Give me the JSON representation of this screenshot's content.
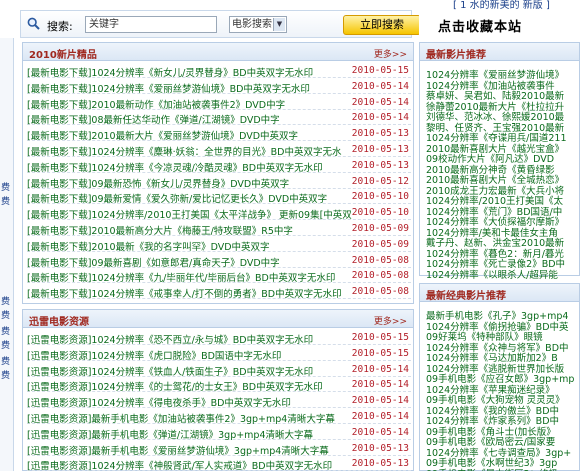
{
  "top_strip": {
    "right_text": "[ 1 水的新美的 新版 ]"
  },
  "search": {
    "label": "搜索:",
    "input_value": "关键字",
    "select_value": "电影搜索",
    "button_label": "立即搜索"
  },
  "bookmark": {
    "label": "点击收藏本站"
  },
  "left_edge_chars": [
    "费",
    "费",
    "费",
    "费",
    "费",
    "费",
    "费",
    "费"
  ],
  "new_releases": {
    "title": "2010新片精品",
    "more": "更多>>",
    "rows": [
      {
        "text": "[最新电影下载]1024分辨率《新女儿/灵界替身》BD中英双字无水印",
        "date": "2010-05-15"
      },
      {
        "text": "[最新电影下载]1024分辨率《爱丽丝梦游仙境》BD中英双字无水印",
        "date": "2010-05-14"
      },
      {
        "text": "[最新电影下载]2010最新动作《加油站被袭事件2》DVD中字",
        "date": "2010-05-14"
      },
      {
        "text": "[最新电影下载]08最新任达华动作《弹道/江湖镜》DVD中字",
        "date": "2010-05-14"
      },
      {
        "text": "[最新电影下载]2010最新大片《爱丽丝梦游仙境》DVD中英双字",
        "date": "2010-05-13"
      },
      {
        "text": "[最新电影下载]1024分辨率《麋琳·妖翁：全世界的目光》BD中英双字无水",
        "date": "2010-05-13"
      },
      {
        "text": "[最新电影下载]1024分辨率《今凉灵魂/冷酷灵魂》BD中英双字无水印",
        "date": "2010-05-13"
      },
      {
        "text": "[最新电影下载]09最新恐怖《新女儿/灵界替身》DVD中英双字",
        "date": "2010-05-12"
      },
      {
        "text": "[最新电影下载]09最新爱情《爱久弥新/爱比记忆更长久》DVD中英双字",
        "date": "2010-05-10"
      },
      {
        "text": "[最新电影下载]1024分辨率/2010王打美国《太平洋战争》 更新09集[中英双",
        "date": "2010-05-10"
      },
      {
        "text": "[最新电影下载]2010最新高分大片《梅藤王/特攻联盟》R5中字",
        "date": "2010-05-09"
      },
      {
        "text": "[最新电影下载]2010最新《我的名字叫罕》DVD中英双字",
        "date": "2010-05-09"
      },
      {
        "text": "[最新电影下载]09最新喜剧《如意郎君/真命天子》DVD中字",
        "date": "2010-05-08"
      },
      {
        "text": "[最新电影下载]1024分辨率《九/毕丽年代/毕丽后台》BD中英双字无水印",
        "date": "2010-05-08"
      },
      {
        "text": "[最新电影下载]1024分辨率《戒事幸人/打不倒的勇者》BD中英双字无水印",
        "date": "2010-05-08"
      }
    ]
  },
  "xunlei": {
    "title": "迅雷电影资源",
    "more": "更多>>",
    "rows": [
      {
        "text": "[迅雷电影资源]1024分辨率《恐不西立/永与城》BD中英双字无水印",
        "date": "2010-05-15"
      },
      {
        "text": "[迅雷电影资源]1024分辨率《虎口脱险》BD国语中字无水印",
        "date": "2010-05-15"
      },
      {
        "text": "[迅雷电影资源]1024分辨率《铁血人/铁面生子》BD中英双字无水印",
        "date": "2010-05-14"
      },
      {
        "text": "[迅雷电影资源]1024分辨率《的士鸳花/的士女王》BD中英双字无水印",
        "date": "2010-05-14"
      },
      {
        "text": "[迅雷电影资源]1024分辨率《得电夜杀手》BD中英双字无水印",
        "date": "2010-05-14"
      },
      {
        "text": "[迅雷电影资源]最新手机电影《加油站被袭事件2》3gp+mp4清晰大字幕",
        "date": "2010-05-14"
      },
      {
        "text": "[迅雷电影资源]最新手机电影《弹道/江湖镜》3gp+mp4清晰大字幕",
        "date": "2010-05-14"
      },
      {
        "text": "[迅雷电影资源]最新手机电影《爱丽丝梦游仙境》3gp+mp4清晰大字幕",
        "date": "2010-05-13"
      },
      {
        "text": "[迅雷电影资源]1024分辨率《神般肾武/军人实戒道》BD中英双字无水印",
        "date": "2010-05-13"
      }
    ]
  },
  "latest_recommend": {
    "title": "最新影片推荐",
    "lines": [
      "1024分辨率《爱丽丝梦游仙境》",
      "1024分辨率《加油站被袭事件",
      "蔡卓妍、吴君如、陆毅2010最新",
      "徐静蕾2010最新大片《杜拉拉升",
      "刘德华、范冰冰、徐熙媛2010最",
      "黎明、任贤齐、王宝强2010最新",
      "1024分辨率《夺谍用兵/国道211",
      "2010最新喜剧大片《越光宝盒》",
      "09校动作大片《阿凡达》DVD",
      "2010最新高分神奇《黄昏绿影",
      "2010最新喜剧大片《全城热恋》",
      "2010成龙王力宏最新《大兵小将",
      "1024分辨率/2010王打美国《太",
      "1024分辨率《荒门》BD国语/中",
      "1024分辨率《大侦探福尔摩斯》",
      "1024分辨率/美和卡最佳女主角",
      "戴子丹、赵新、洪金宝2010最新",
      "1024分辨率《暮色2：新月/暮光",
      "1024分辨率《死亡录像2》BD中",
      "1024分辨率《以眼杀人/超异能"
    ]
  },
  "classic_recommend": {
    "title": "最新经典影片推荐",
    "lines": [
      "最新手机电影《孔子》3gp+mp4",
      "1024分辨率《偷拐抢骗》BD中英",
      "09好莱坞《特种部队》眼镜",
      "1024分辨率《众神与将军》BD中",
      "1024分辨率《马达加斯加2》B",
      "1024分辨率《逃脱新世界加长版",
      "09手机电影《应召女郎》3gp+mp",
      "1024分辨率《苹果痴迷纪录》",
      "09手机电影《大狗宠物 灵灵灵》",
      "1024分辨率《我的傲兰》BD中",
      "1024分辨率《炸家系列》BD中",
      "09手机电影《角斗士(加长版》",
      "09手机电影《欧局密云/国家要",
      "1024分辨率《七寺调查局》3gp+",
      "09手机电影《水啊世纪3》3gp",
      "09手机电影《暴力街区2：终极"
    ]
  }
}
